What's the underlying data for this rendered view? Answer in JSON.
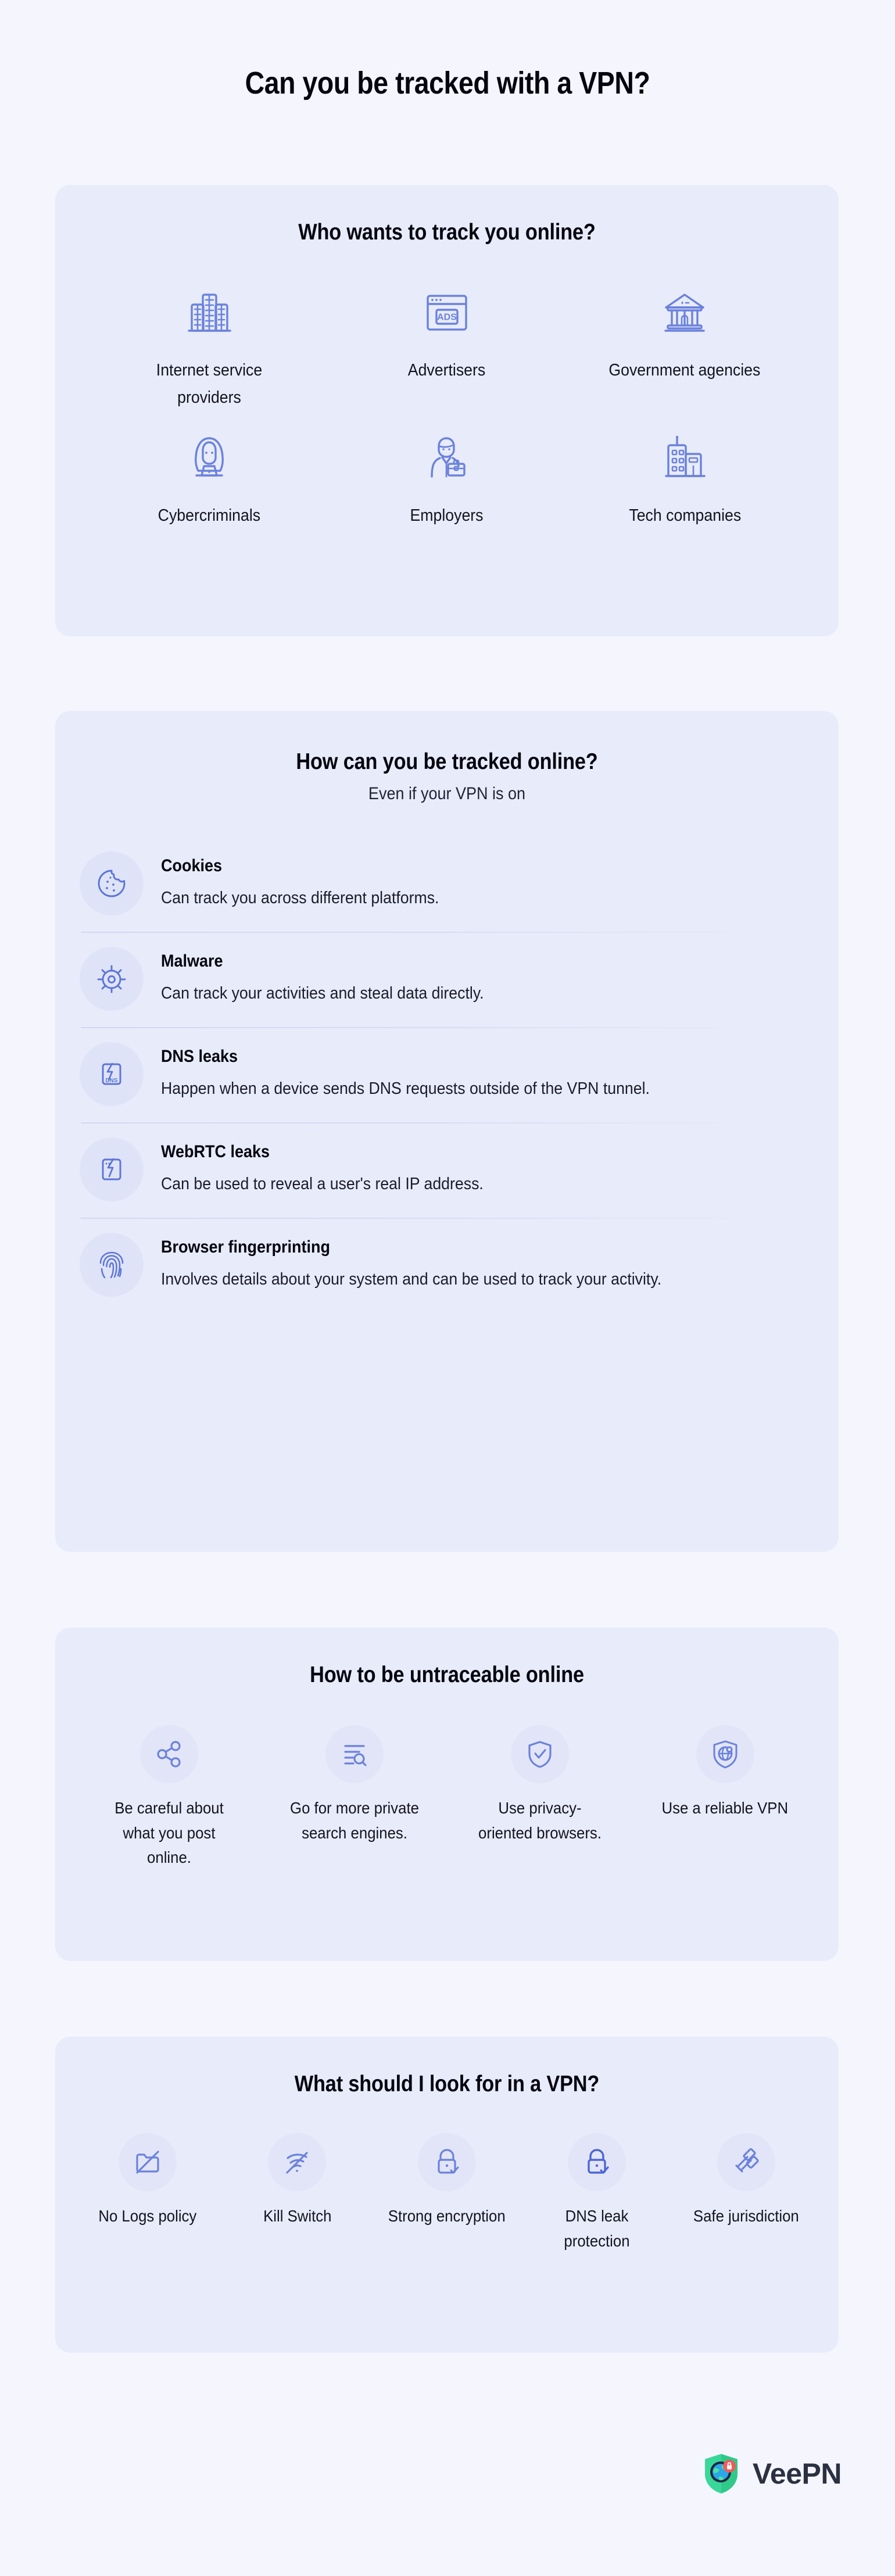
{
  "page": {
    "title": "Can you be tracked with a VPN?",
    "bg_color": "#f5f6fd",
    "card_color": "#e8ebfa",
    "icon_color": "#6b82dc"
  },
  "who_section": {
    "title": "Who wants to track you online?",
    "items": [
      {
        "label": "Internet service providers",
        "icon": "office-buildings-icon"
      },
      {
        "label": "Advertisers",
        "icon": "ads-browser-window-icon"
      },
      {
        "label": "Government agencies",
        "icon": "government-building-icon"
      },
      {
        "label": "Cybercriminals",
        "icon": "hacker-hoodie-laptop-icon"
      },
      {
        "label": "Employers",
        "icon": "businessman-briefcase-icon"
      },
      {
        "label": "Tech companies",
        "icon": "tech-office-tower-icon"
      }
    ]
  },
  "how_section": {
    "title": "How can you be tracked online?",
    "subtitle": "Even if your VPN is on",
    "items": [
      {
        "term": "Cookies",
        "description": "Can track you across different platforms.",
        "icon": "cookie-icon"
      },
      {
        "term": "Malware",
        "description": "Can track your activities and steal data directly.",
        "icon": "malware-bug-icon"
      },
      {
        "term": "DNS leaks",
        "description": "Happen when a device sends DNS requests outside of the VPN tunnel.",
        "icon": "dns-leak-phone-icon"
      },
      {
        "term": "WebRTC leaks",
        "description": "Can be used to reveal a user's real IP address.",
        "icon": "webrtc-leak-phone-icon"
      },
      {
        "term": "Browser fingerprinting",
        "description": "Involves details about your system and can be used to track your activity.",
        "icon": "fingerprint-icon"
      }
    ]
  },
  "untraceable_section": {
    "title": "How to be untraceable online",
    "items": [
      {
        "label": "Be careful about what you post online.",
        "icon": "share-nodes-icon"
      },
      {
        "label": "Go for more private search engines.",
        "icon": "search-list-icon"
      },
      {
        "label": "Use privacy-oriented browsers.",
        "icon": "shield-check-icon"
      },
      {
        "label": "Use a reliable VPN",
        "icon": "shield-globe-icon"
      }
    ]
  },
  "vpn_features_section": {
    "title": "What should I look for in a VPN?",
    "items": [
      {
        "label": "No Logs policy",
        "icon": "folder-crossed-out-icon"
      },
      {
        "label": "Kill Switch",
        "icon": "wifi-off-icon"
      },
      {
        "label": "Strong encryption",
        "icon": "lock-check-icon"
      },
      {
        "label": "DNS leak protection",
        "icon": "lock-check-filled-icon"
      },
      {
        "label": "Safe jurisdiction",
        "icon": "gavel-icon"
      }
    ]
  },
  "footer": {
    "brand": "VeePN",
    "logo_icon": "veepn-shield-globe-logo"
  }
}
